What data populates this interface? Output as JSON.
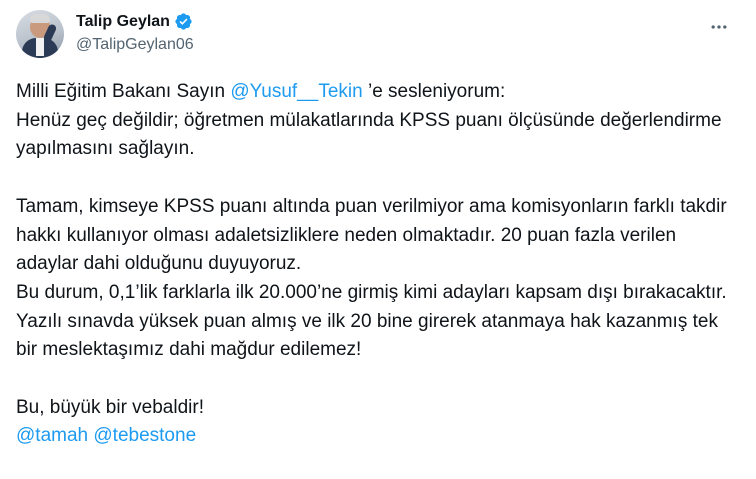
{
  "author": {
    "name": "Talip Geylan",
    "handle": "@TalipGeylan06"
  },
  "icons": {
    "more": "more-horizontal-icon",
    "verified": "verified-badge-icon"
  },
  "colors": {
    "accent": "#1d9bf0",
    "text": "#0f1419",
    "muted": "#536471"
  },
  "tweet": {
    "line1_before": "Milli Eğitim Bakanı Sayın ",
    "line1_mention": "@Yusuf__Tekin",
    "line1_after": " ’e sesleniyorum:",
    "para1": "Henüz geç değildir; öğretmen mülakatlarında KPSS puanı ölçüsünde değerlendirme yapılmasını sağlayın.",
    "para2": "Tamam, kimseye KPSS puanı altında puan verilmiyor ama komisyonların farklı takdir hakkı kullanıyor olması adaletsizliklere neden olmaktadır. 20 puan fazla verilen adaylar dahi olduğunu duyuyoruz.",
    "para3": "Bu durum, 0,1’lik farklarla ilk 20.000’ne girmiş kimi adayları kapsam dışı bırakacaktır.",
    "para4": "Yazılı sınavda yüksek puan almış ve ilk 20 bine girerek atanmaya hak kazanmış tek bir meslektaşımız dahi mağdur edilemez!",
    "para5": "Bu, büyük bir vebaldir!",
    "mention2": "@tamah",
    "mention3": "@tebestone"
  }
}
